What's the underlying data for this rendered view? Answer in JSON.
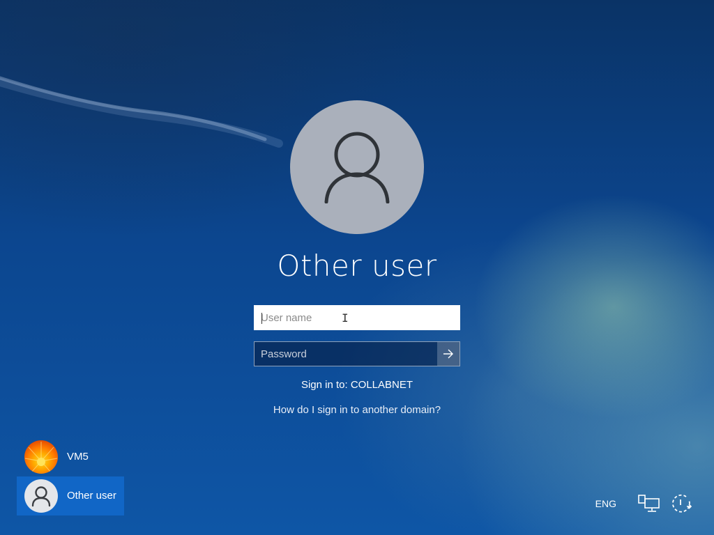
{
  "login": {
    "user_title": "Other user",
    "username_placeholder": "User name",
    "username_value": "",
    "password_placeholder": "Password",
    "password_value": "",
    "sign_in_to": "Sign in to: COLLABNET",
    "domain_help_link": "How do I sign in to another domain?"
  },
  "user_list": [
    {
      "name": "VM5",
      "avatar": "flower-icon",
      "selected": false
    },
    {
      "name": "Other user",
      "avatar": "person-icon",
      "selected": true
    }
  ],
  "system_tray": {
    "language": "ENG",
    "network_icon": "network-icon",
    "power_icon": "power-icon"
  },
  "colors": {
    "background": "#0b3f86",
    "selected_tile": "#1166c6",
    "avatar_bg": "#aab0bb",
    "avatar_glyph": "#2f3338"
  }
}
